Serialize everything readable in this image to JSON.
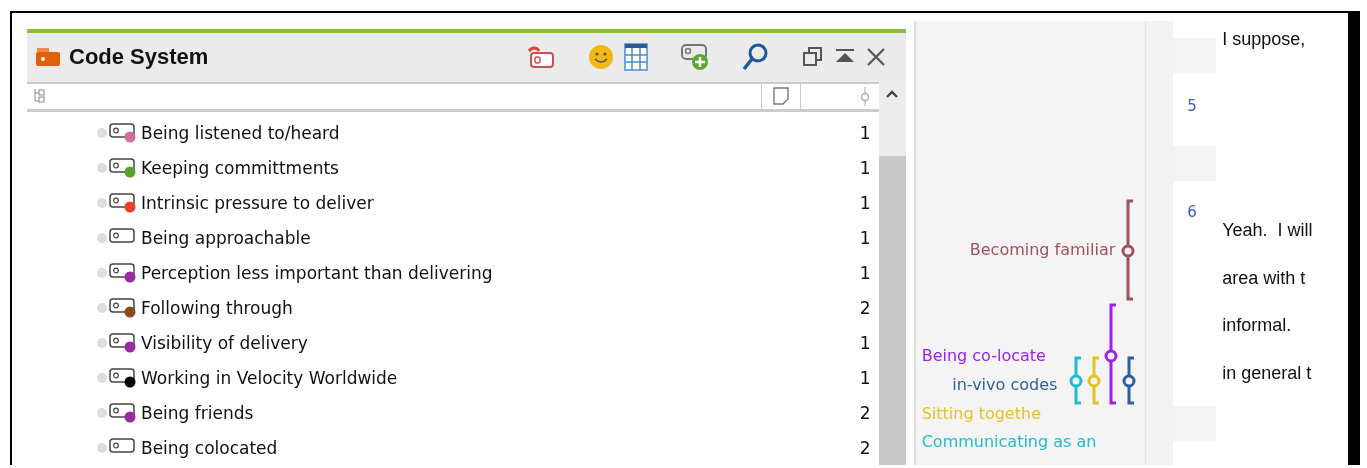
{
  "panel": {
    "title": "Code System"
  },
  "codes": [
    {
      "name": "Being listened to/heard",
      "count": "1",
      "color": "#d0709a"
    },
    {
      "name": "Keeping committments",
      "count": "1",
      "color": "#5aa02c"
    },
    {
      "name": "Intrinsic pressure to deliver",
      "count": "1",
      "color": "#e8402c"
    },
    {
      "name": "Being approachable",
      "count": "1"
    },
    {
      "name": "Perception less important than delivering",
      "count": "1",
      "color": "#9a2aa0"
    },
    {
      "name": "Following through",
      "count": "2",
      "color": "#8a4a1a"
    },
    {
      "name": "Visibility of delivery",
      "count": "1",
      "color": "#9a2aa0"
    },
    {
      "name": "Working in Velocity Worldwide",
      "count": "1",
      "color": "#000000"
    },
    {
      "name": "Being friends",
      "count": "2",
      "color": "#9a2aa0"
    },
    {
      "name": "Being colocated",
      "count": "2"
    }
  ],
  "stripes": [
    {
      "label": "Becoming familiar",
      "color": "#a0525e"
    },
    {
      "label": "Being co-locate",
      "color": "#a020f0"
    },
    {
      "label": "in-vivo codes",
      "color": "#2f5f9a"
    },
    {
      "label": "Sitting togethe",
      "color": "#e8c020"
    },
    {
      "label": "Communicating as an",
      "color": "#20bcd0"
    }
  ],
  "document": {
    "line_numbers": [
      "5",
      "6"
    ],
    "lines": [
      "I suppose,",
      "Yeah.  I will",
      "area with t",
      "informal.",
      "in general t"
    ]
  }
}
